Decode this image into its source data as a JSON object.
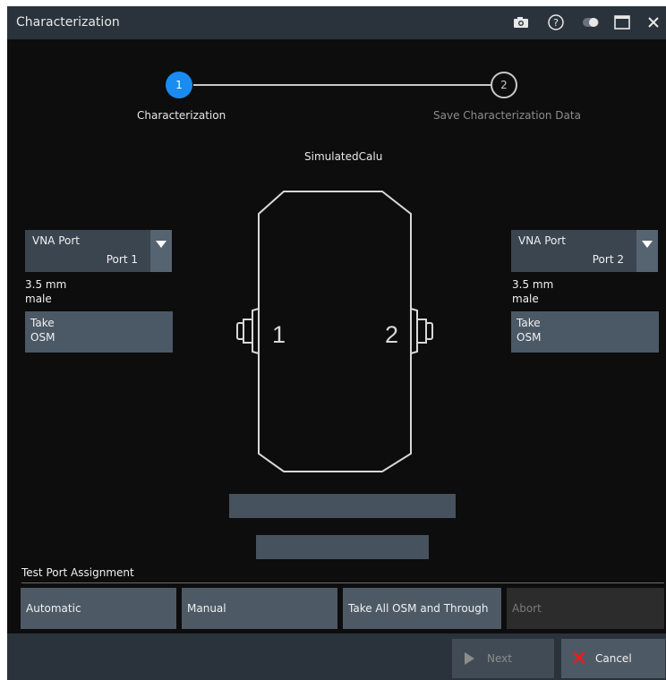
{
  "window": {
    "title": "Characterization",
    "icons": [
      "camera-icon",
      "help-icon",
      "toggle-icon",
      "maximize-icon",
      "close-icon"
    ]
  },
  "wizard": {
    "steps": [
      {
        "number": "1",
        "label": "Characterization",
        "active": true
      },
      {
        "number": "2",
        "label": "Save Characterization Data",
        "active": false
      }
    ]
  },
  "cal_unit": {
    "name": "SimulatedCalu",
    "port_numbers": [
      "1",
      "2"
    ]
  },
  "left_port": {
    "select_label": "VNA Port",
    "select_value": "Port 1",
    "connector_size": "3.5 mm",
    "connector_gender": "male",
    "take_line1": "Take",
    "take_line2": "OSM"
  },
  "right_port": {
    "select_label": "VNA Port",
    "select_value": "Port 2",
    "connector_size": "3.5 mm",
    "connector_gender": "male",
    "take_line1": "Take",
    "take_line2": "OSM"
  },
  "assignment": {
    "section_label": "Test Port Assignment",
    "automatic": "Automatic",
    "manual": "Manual",
    "take_all": "Take All OSM and Through",
    "abort": "Abort"
  },
  "footer": {
    "next": "Next",
    "cancel": "Cancel"
  },
  "colors": {
    "accent": "#1a8bf0",
    "titlebar": "#2a323b",
    "button": "#4d5a66",
    "cancel_icon": "#e02020"
  }
}
